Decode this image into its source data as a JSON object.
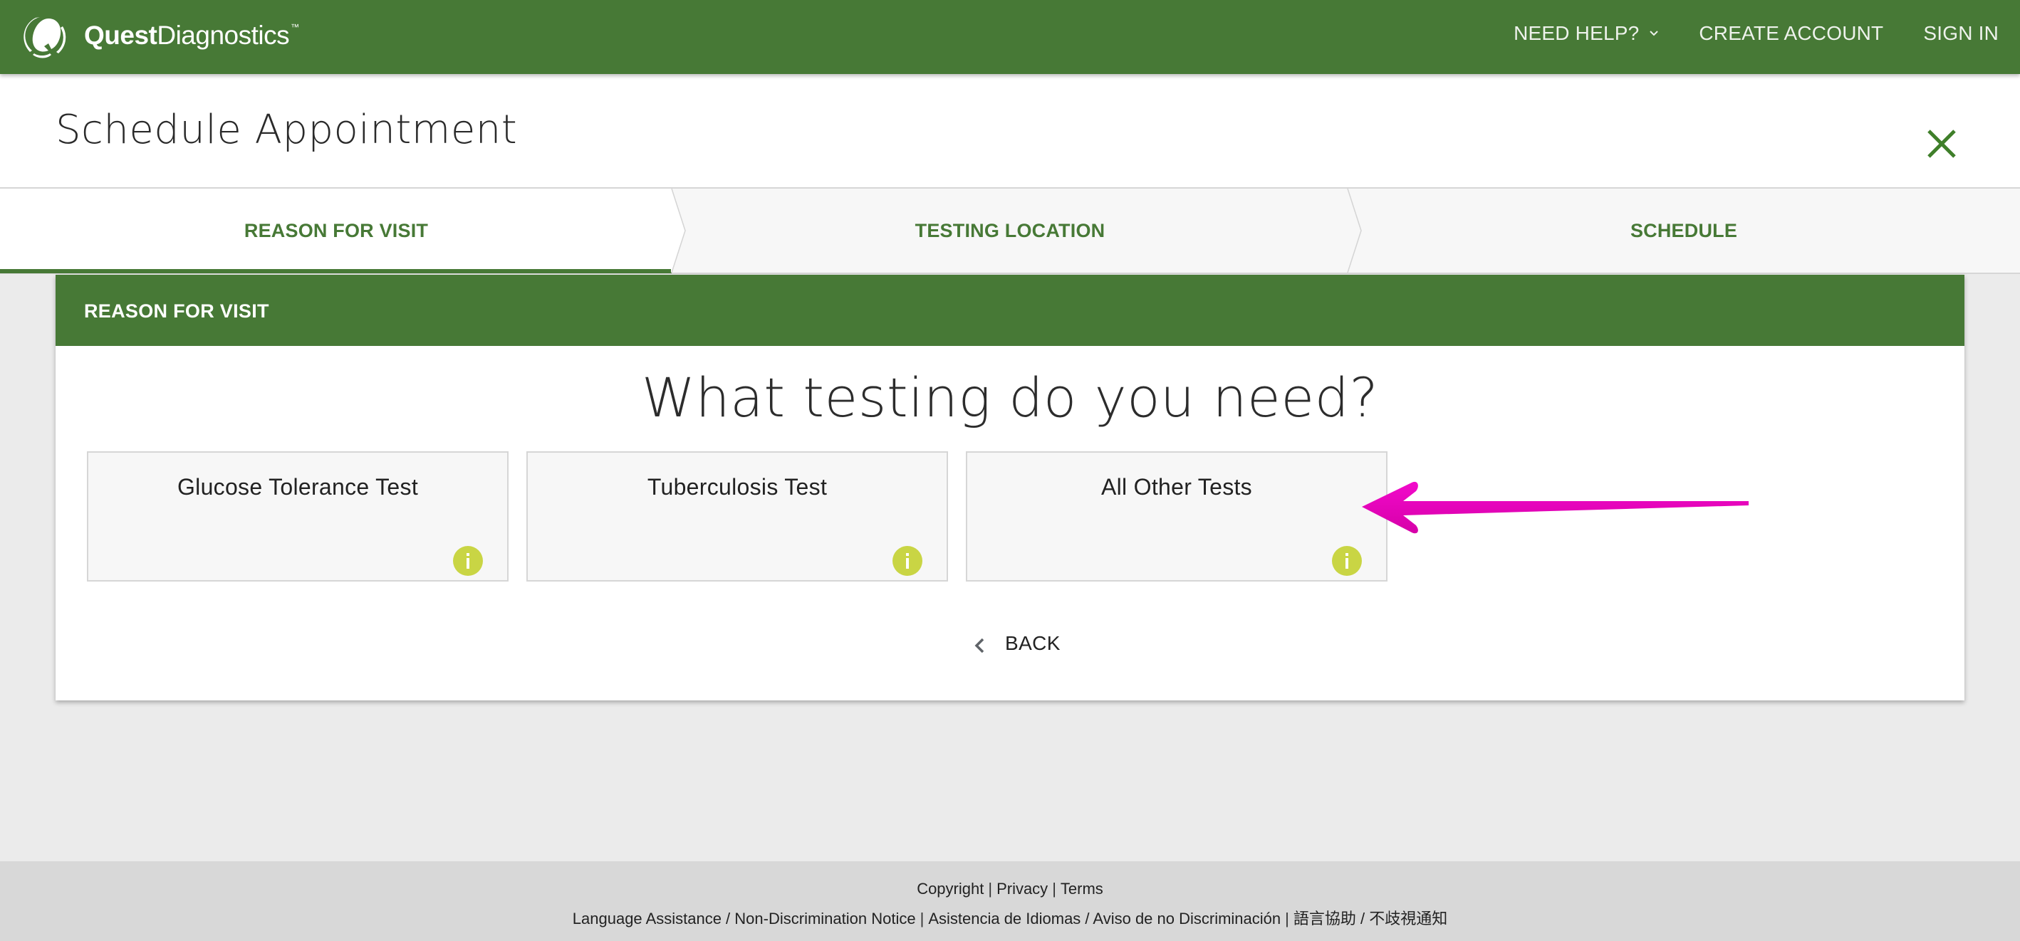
{
  "header": {
    "brand_bold": "Quest",
    "brand_light": "Diagnostics",
    "brand_tm": "™",
    "logo_icon": "quest-q-logo-icon",
    "nav": [
      {
        "label": "NEED HELP?",
        "has_dropdown": true
      },
      {
        "label": "CREATE ACCOUNT"
      },
      {
        "label": "SIGN IN"
      }
    ]
  },
  "page": {
    "title": "Schedule Appointment",
    "close_icon": "close-icon"
  },
  "stepper": {
    "steps": [
      {
        "label": "REASON FOR VISIT",
        "active": true
      },
      {
        "label": "TESTING LOCATION",
        "active": false
      },
      {
        "label": "SCHEDULE",
        "active": false
      }
    ]
  },
  "card": {
    "header_label": "REASON FOR VISIT",
    "question": "What testing do you need?",
    "options": [
      {
        "label": "Glucose Tolerance Test",
        "icon": "info-icon"
      },
      {
        "label": "Tuberculosis Test",
        "icon": "info-icon"
      },
      {
        "label": "All Other Tests",
        "icon": "info-icon"
      }
    ],
    "back_label": "BACK"
  },
  "annotation": {
    "type": "arrow",
    "points_to": "All Other Tests",
    "color": "#e800c0"
  },
  "footer": {
    "row1": [
      "Copyright",
      "Privacy",
      "Terms"
    ],
    "row2": [
      "Language Assistance / Non-Discrimination Notice",
      "Asistencia de Idiomas / Aviso de no Discriminación",
      "語言協助 / 不歧視通知"
    ]
  },
  "colors": {
    "brand_green": "#477936",
    "info_icon": "#c9d544",
    "background": "#ebebeb",
    "footer_bg": "#d8d8d8"
  }
}
